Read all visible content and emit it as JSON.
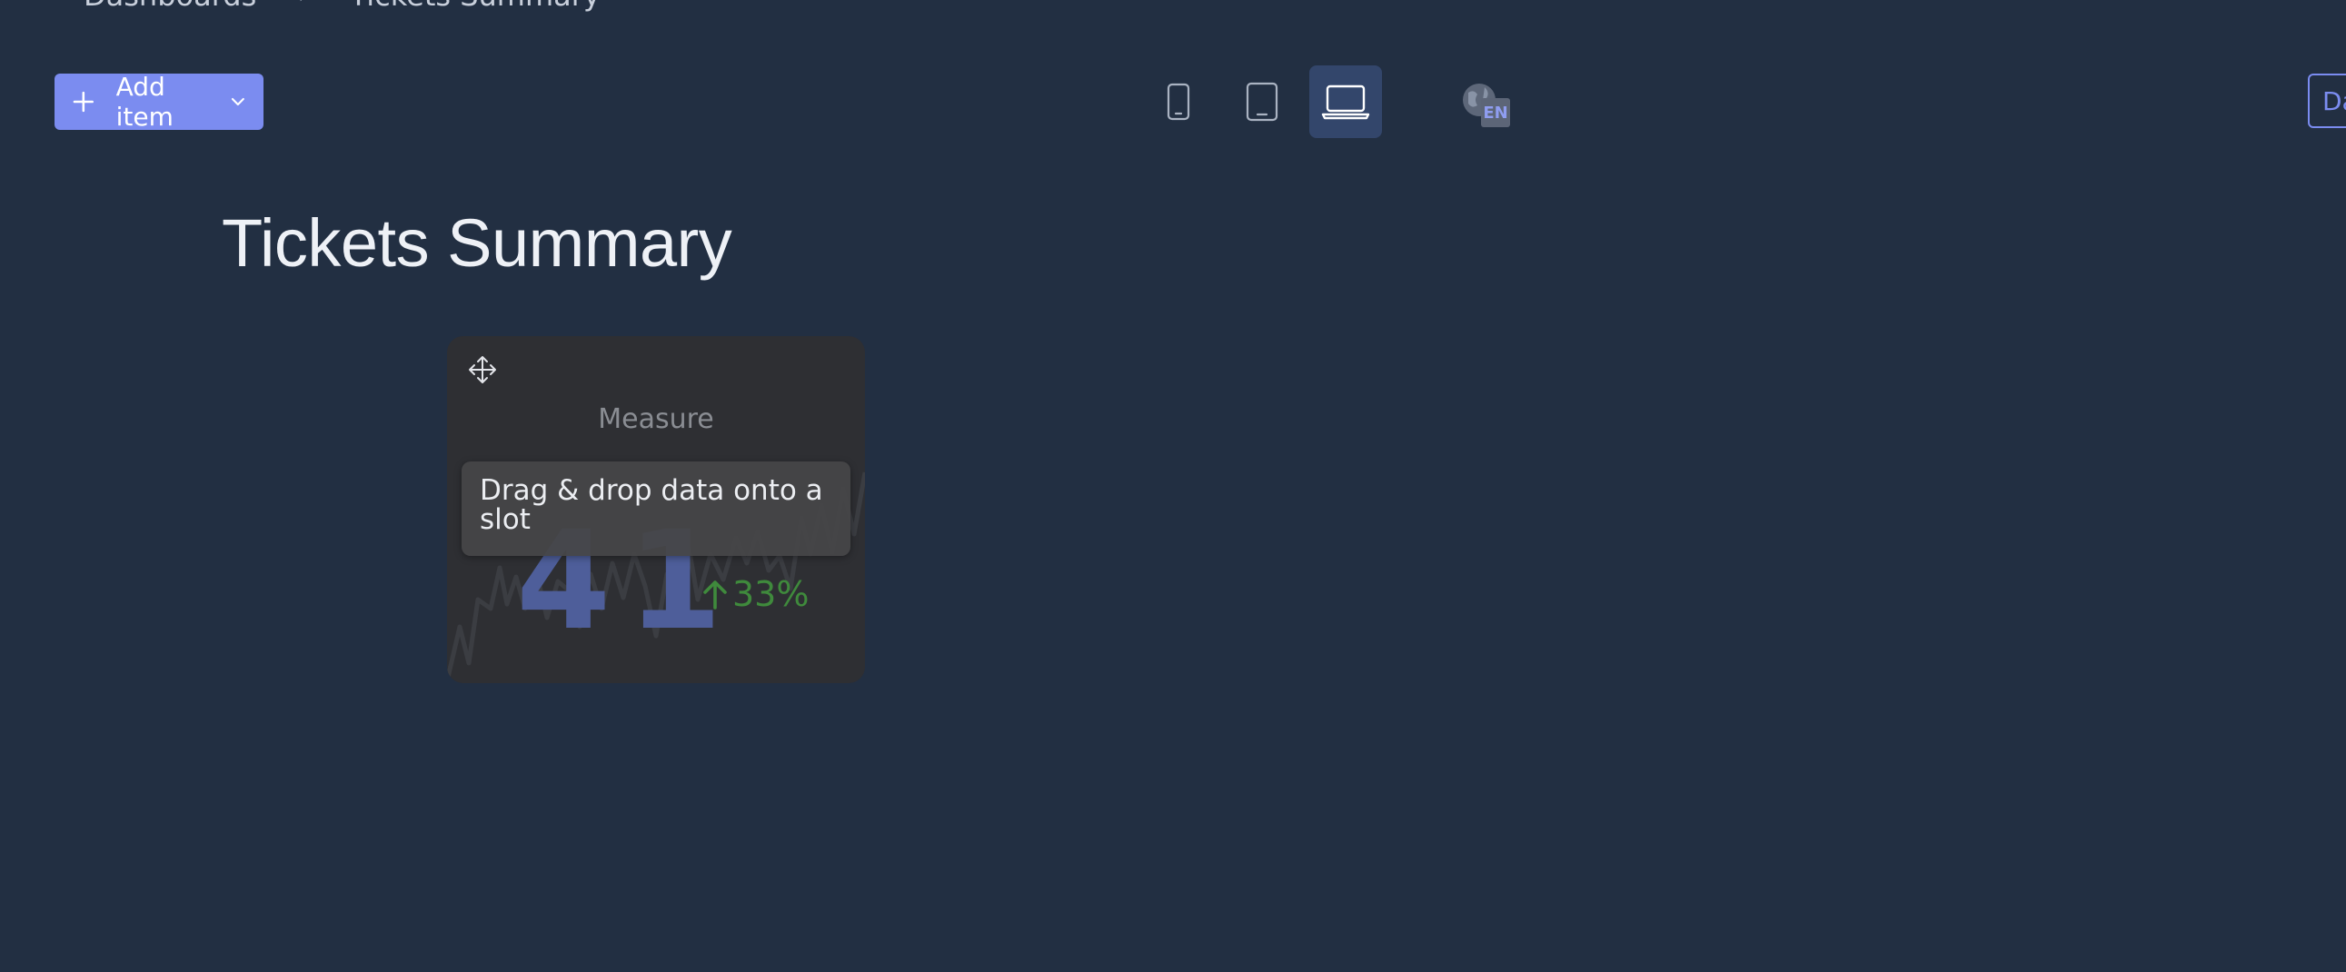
{
  "breadcrumb": {
    "items": [
      "Dashboards",
      "Tickets Summary"
    ],
    "separator": "›"
  },
  "toolbar": {
    "add_item_label": "Add item",
    "devices": [
      "mobile-icon",
      "tablet-icon",
      "laptop-icon"
    ],
    "active_device": "laptop",
    "language_badge": "EN",
    "right_button_label": "Da"
  },
  "page_title": "Tickets Summary",
  "card": {
    "measure_label": "Measure",
    "value": "41",
    "delta": "33%",
    "delta_direction": "up",
    "drop_hint": "Drag & drop data onto a slot"
  },
  "colors": {
    "background": "#222f42",
    "accent": "#7b8cf0",
    "positive": "#3f8a3c",
    "value": "#4e5e9a"
  }
}
